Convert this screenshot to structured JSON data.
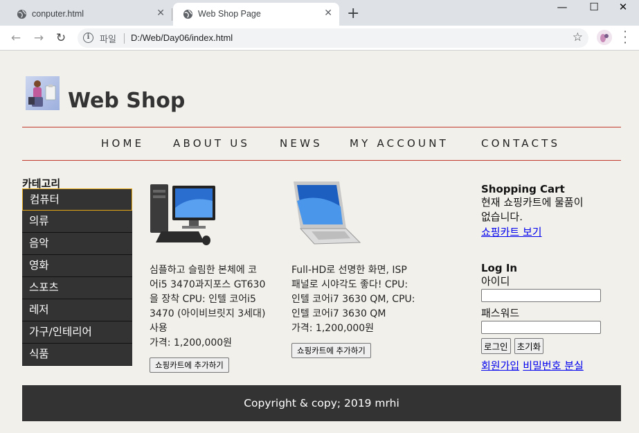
{
  "browser": {
    "tabs": [
      {
        "title": "conputer.html",
        "active": false
      },
      {
        "title": "Web Shop Page",
        "active": true
      }
    ],
    "address": {
      "scheme_label": "파일",
      "url": "D:/Web/Day06/index.html"
    }
  },
  "header": {
    "title": "Web Shop"
  },
  "nav": [
    "HOME",
    "ABOUT US",
    "NEWS",
    "MY ACCOUNT",
    "CONTACTS"
  ],
  "categories": {
    "title": "카테고리",
    "items": [
      "컴퓨터",
      "의류",
      "음악",
      "영화",
      "스포츠",
      "레저",
      "가구/인테리어",
      "식품"
    ],
    "selected_index": 0
  },
  "products": [
    {
      "desc_lines": [
        "심플하고 슬림한 본체에 코",
        "어i5 3470과지포스 GT630",
        "을 장착 CPU: 인텔 코어i5",
        "3470 (아이비브릿지 3세대)",
        "사용"
      ],
      "price": "가격: 1,200,000원",
      "button": "쇼핑카트에 추가하기"
    },
    {
      "desc_lines": [
        "Full-HD로 선명한 화면, ISP",
        "패널로 시야각도 좋다! CPU:",
        "인텔 코어i7 3630 QM, CPU:",
        "인텔 코어i7 3630 QM"
      ],
      "price": "가격: 1,200,000원",
      "button": "쇼핑카트에 추가하기"
    }
  ],
  "cart": {
    "title": "Shopping Cart",
    "message_lines": [
      "현재 쇼핑카트에 물품이",
      "없습니다."
    ],
    "link": "쇼핑카트 보기"
  },
  "login": {
    "title": "Log In",
    "id_label": "아이디",
    "id_value": "",
    "pw_label": "패스워드",
    "pw_value": "",
    "login_button": "로그인",
    "reset_button": "초기화",
    "signup_link": "회원가입",
    "find_pw_link": "비밀번호 분실"
  },
  "footer": {
    "text": "Copyright & copy; 2019 mrhi"
  },
  "colors": {
    "rule": "#c0392b",
    "dark": "#333333",
    "selected_border": "#e6a817",
    "link": "#0000ee"
  }
}
